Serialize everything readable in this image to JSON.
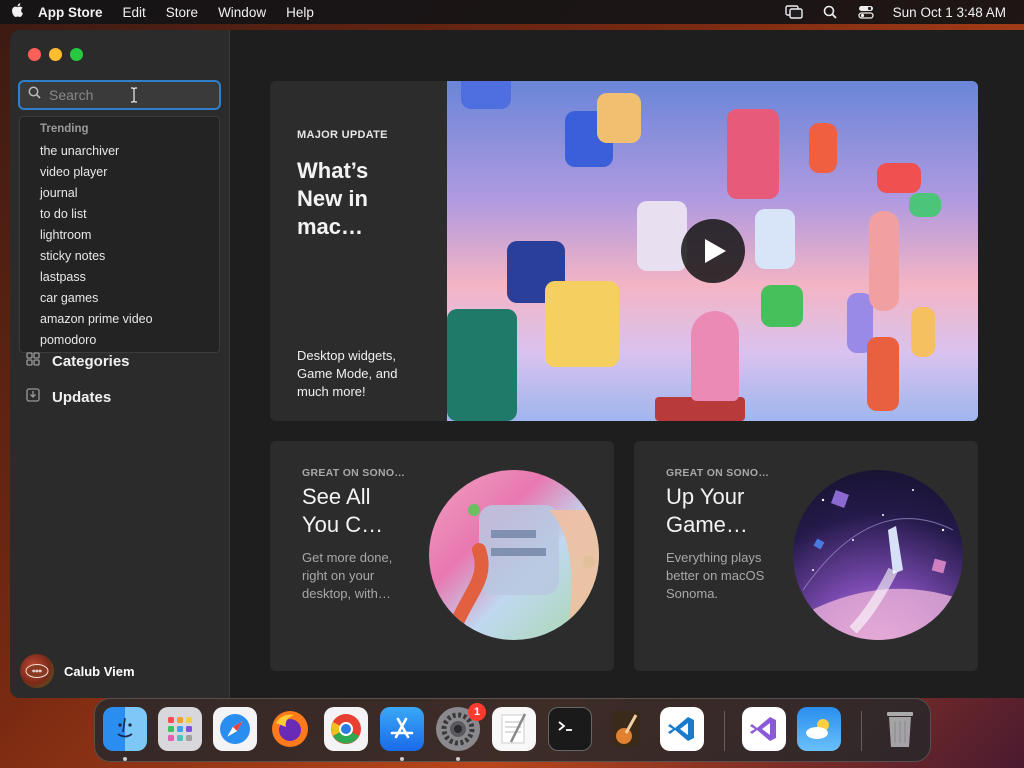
{
  "menubar": {
    "app_name": "App Store",
    "items": [
      "Edit",
      "Store",
      "Window",
      "Help"
    ],
    "clock": "Sun Oct 1  3:48 AM"
  },
  "sidebar": {
    "search_placeholder": "Search",
    "trending_header": "Trending",
    "suggestions": [
      "the unarchiver",
      "video player",
      "journal",
      "to do list",
      "lightroom",
      "sticky notes",
      "lastpass",
      "car games",
      "amazon prime video",
      "pomodoro"
    ],
    "nav": [
      "Categories",
      "Updates"
    ],
    "user_name": "Calub Viem"
  },
  "hero": {
    "eyebrow": "MAJOR UPDATE",
    "title": "What’s New in mac…",
    "subtitle": "Desktop widgets, Game Mode, and much more!"
  },
  "cards": [
    {
      "eyebrow": "GREAT ON SONO…",
      "title": "See All You C…",
      "subtitle": "Get more done, right on your desktop, with…"
    },
    {
      "eyebrow": "GREAT ON SONO…",
      "title": "Up Your Game…",
      "subtitle": "Everything plays better on macOS Sonoma."
    }
  ],
  "dock": {
    "settings_badge": "1"
  },
  "colors": {
    "accent": "#2f7fc9",
    "window_bg": "#1e1e1e",
    "sidebar_bg": "#2b2b2c",
    "card_bg": "#2c2c2d"
  }
}
